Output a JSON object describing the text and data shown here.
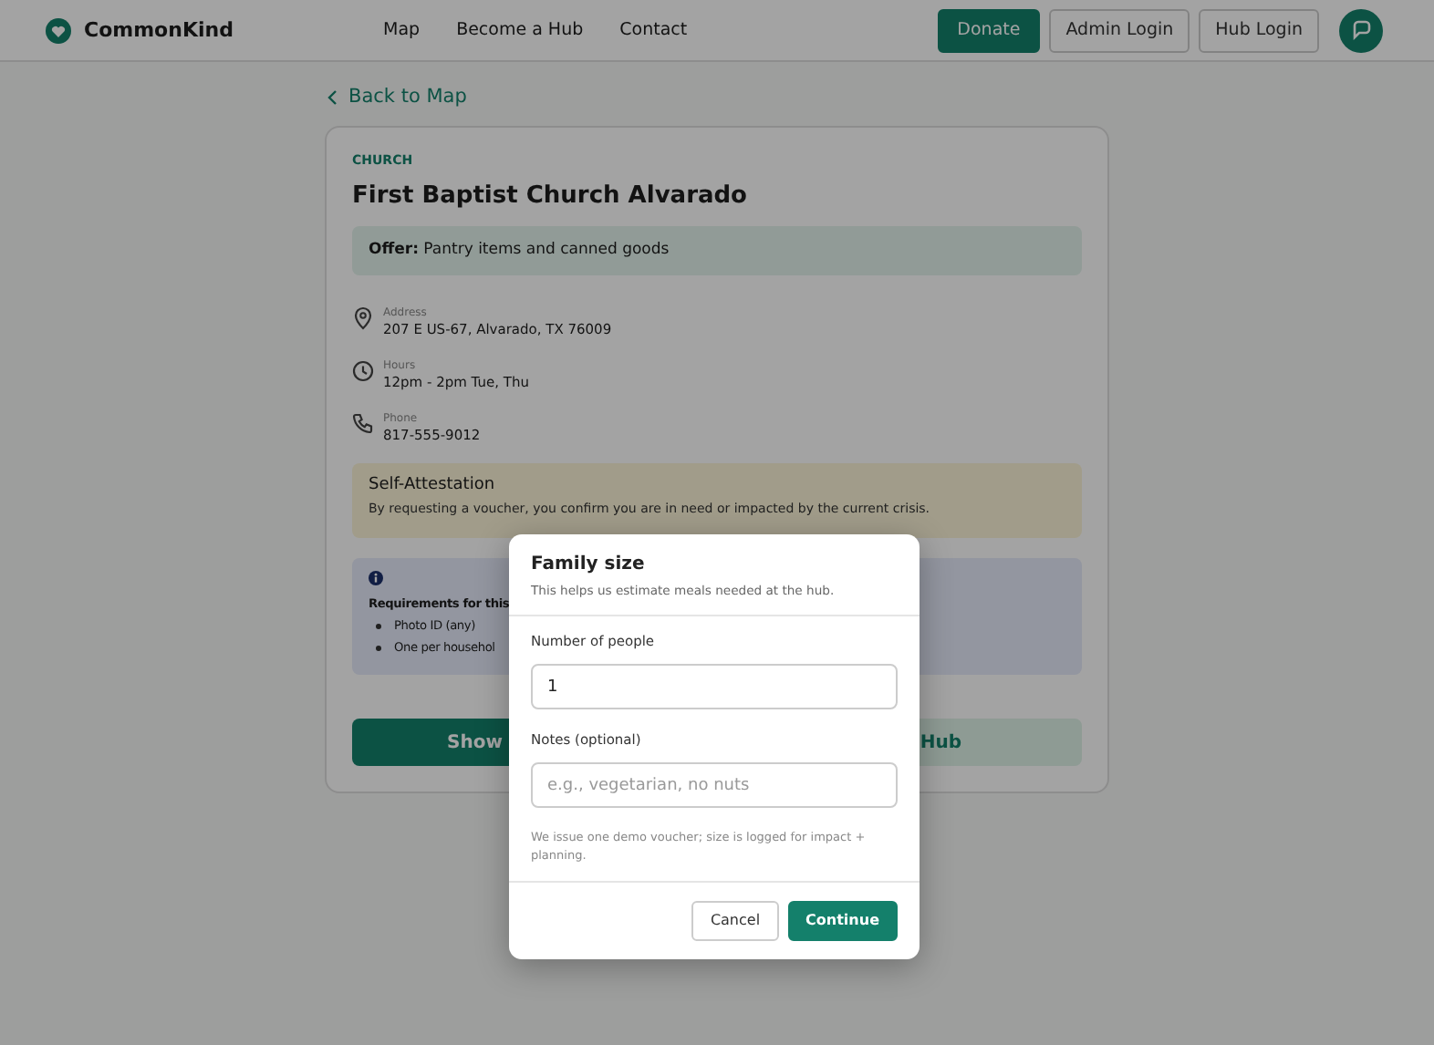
{
  "header": {
    "brand": "CommonKind",
    "nav": [
      {
        "label": "Map"
      },
      {
        "label": "Become a Hub"
      },
      {
        "label": "Contact"
      }
    ],
    "actions": [
      {
        "label": "Donate",
        "kind": "primary"
      },
      {
        "label": "Admin Login",
        "kind": "outline"
      },
      {
        "label": "Hub Login",
        "kind": "outline"
      }
    ]
  },
  "back_link": "Back to Map",
  "hub": {
    "category": "CHURCH",
    "name": "First Baptist Church Alvarado",
    "offer_label": "Offer:",
    "offer": "Pantry items and canned goods",
    "details": [
      {
        "kind": "address",
        "label": "Address",
        "value": "207 E US-67, Alvarado, TX 76009"
      },
      {
        "kind": "hours",
        "label": "Hours",
        "value": "12pm - 2pm Tue, Thu"
      },
      {
        "kind": "phone",
        "label": "Phone",
        "value": "817-555-9012"
      }
    ],
    "attestation": {
      "title": "Self-Attestation",
      "text": "By requesting a voucher, you confirm you are in need or impacted by the current crisis."
    },
    "requirements": {
      "title": "Requirements for this",
      "items": [
        "Photo ID (any)",
        "One per househol"
      ]
    },
    "buttons": [
      {
        "label": "Show",
        "kind": "primary"
      },
      {
        "label": "Hub",
        "kind": "secondary"
      }
    ]
  },
  "modal": {
    "title": "Family size",
    "subtitle": "This helps us estimate meals needed at the hub.",
    "fields": [
      {
        "label": "Number of people",
        "value": "1"
      },
      {
        "label": "Notes (optional)",
        "placeholder": "e.g., vegetarian, no nuts"
      }
    ],
    "note": "We issue one demo voucher; size is logged for impact + planning.",
    "buttons": [
      {
        "label": "Cancel",
        "kind": "secondary"
      },
      {
        "label": "Continue",
        "kind": "primary"
      }
    ]
  }
}
